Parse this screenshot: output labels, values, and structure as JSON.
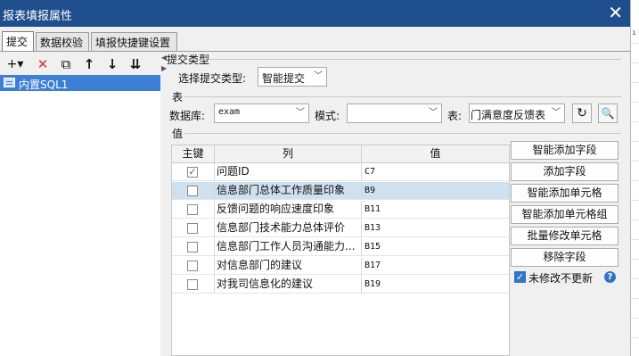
{
  "window": {
    "title": "报表填报属性",
    "close": "✕"
  },
  "tabs": [
    {
      "label": "提交"
    },
    {
      "label": "数据校验"
    },
    {
      "label": "填报快捷键设置"
    }
  ],
  "toolbar": {
    "add": "+▾",
    "delete": "✕",
    "copy": "⧉",
    "up": "↑",
    "down": "↓",
    "sort": "⇊"
  },
  "tree": {
    "items": [
      {
        "label": "内置SQL1"
      }
    ]
  },
  "submit": {
    "section_label": "提交类型",
    "type_label": "选择提交类型:",
    "type_value": "智能提交"
  },
  "table_section": {
    "section_label": "表",
    "db_label": "数据库:",
    "db_value": "exam",
    "schema_label": "模式:",
    "schema_value": "",
    "table_label": "表:",
    "table_value": "门满意度反馈表"
  },
  "values_section": {
    "section_label": "值",
    "columns": {
      "key": "主键",
      "col": "列",
      "val": "值"
    },
    "rows": [
      {
        "key": true,
        "col": "问题ID",
        "val": "C7"
      },
      {
        "key": false,
        "col": "信息部门总体工作质量印象",
        "val": "B9",
        "selected": true
      },
      {
        "key": false,
        "col": "反馈问题的响应速度印象",
        "val": "B11"
      },
      {
        "key": false,
        "col": "信息部门技术能力总体评价",
        "val": "B13"
      },
      {
        "key": false,
        "col": "信息部门工作人员沟通能力...",
        "val": "B15"
      },
      {
        "key": false,
        "col": "对信息部门的建议",
        "val": "B17"
      },
      {
        "key": false,
        "col": "对我司信息化的建议",
        "val": "B19"
      }
    ]
  },
  "actions": {
    "smart_add_field": "智能添加字段",
    "add_field": "添加字段",
    "smart_add_cell": "智能添加单元格",
    "smart_add_cell_group": "智能添加单元格组",
    "batch_edit_cell": "批量修改单元格",
    "remove_field": "移除字段",
    "no_update_unmodified": "未修改不更新",
    "help": "?"
  },
  "outside": {
    "mark": "ı"
  }
}
